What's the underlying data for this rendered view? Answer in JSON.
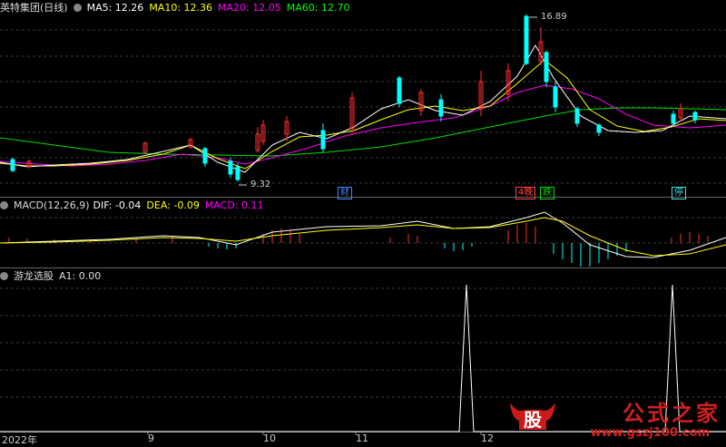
{
  "header": {
    "stock_name": "英特集团(日线)",
    "ma5": "MA5: 12.26",
    "ma10": "MA10: 12.36",
    "ma20": "MA20: 12.05",
    "ma60": "MA60: 12.70",
    "colors": {
      "ma5": "#ffffff",
      "ma10": "#ffff00",
      "ma20": "#ff00ff",
      "ma60": "#00ff00"
    }
  },
  "price_labels": {
    "high": "16.89",
    "low": "9.32"
  },
  "event_tags": [
    {
      "text": "财",
      "color": "#4488ff"
    },
    {
      "text": "4晚",
      "color": "#ff4444"
    },
    {
      "text": "跌",
      "color": "#00dd00"
    },
    {
      "text": "停",
      "color": "#44dddd"
    }
  ],
  "macd": {
    "title": "MACD(12,26,9)",
    "dif": "DIF: -0.04",
    "dea": "DEA: -0.09",
    "macd": "MACD: 0.11"
  },
  "indicator": {
    "title": "游龙选股",
    "a1": "A1: 0.00"
  },
  "x_axis": [
    "2022年",
    "9",
    "10",
    "11",
    "12"
  ],
  "watermark": {
    "logo_text": "股",
    "name": "公式之家",
    "url": "www.gszj100.com"
  }
}
